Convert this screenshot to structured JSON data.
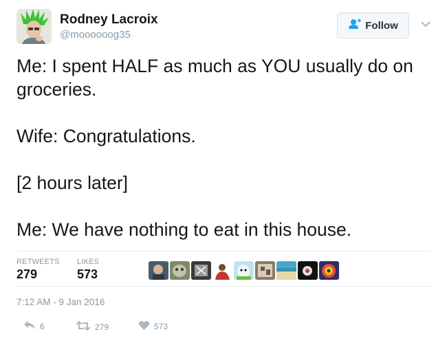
{
  "author": {
    "name": "Rodney Lacroix",
    "handle": "@moooooog35",
    "avatar_icon": "profile-photo-green-mohawk"
  },
  "follow_button": {
    "label": "Follow",
    "icon": "add-user-icon",
    "accent_color": "#1da1f2"
  },
  "menu": {
    "icon": "chevron-down-icon"
  },
  "tweet": {
    "lines": [
      "Me: I spent HALF as much as YOU usually do on groceries.",
      "Wife: Congratulations.",
      "[2 hours later]",
      "Me: We have nothing to eat in this house."
    ]
  },
  "stats": {
    "retweets_label": "RETWEETS",
    "retweets": "279",
    "likes_label": "LIKES",
    "likes": "573"
  },
  "likers": [
    "liker-avatar-1",
    "liker-avatar-2",
    "liker-avatar-3",
    "liker-avatar-4",
    "liker-avatar-5",
    "liker-avatar-6",
    "liker-avatar-7",
    "liker-avatar-8",
    "liker-avatar-9"
  ],
  "timestamp": "7:12 AM - 9 Jan 2016",
  "actions": {
    "reply_count": "6",
    "retweet_count": "279",
    "like_count": "573",
    "reply_icon": "reply-icon",
    "retweet_icon": "retweet-icon",
    "like_icon": "heart-icon"
  }
}
